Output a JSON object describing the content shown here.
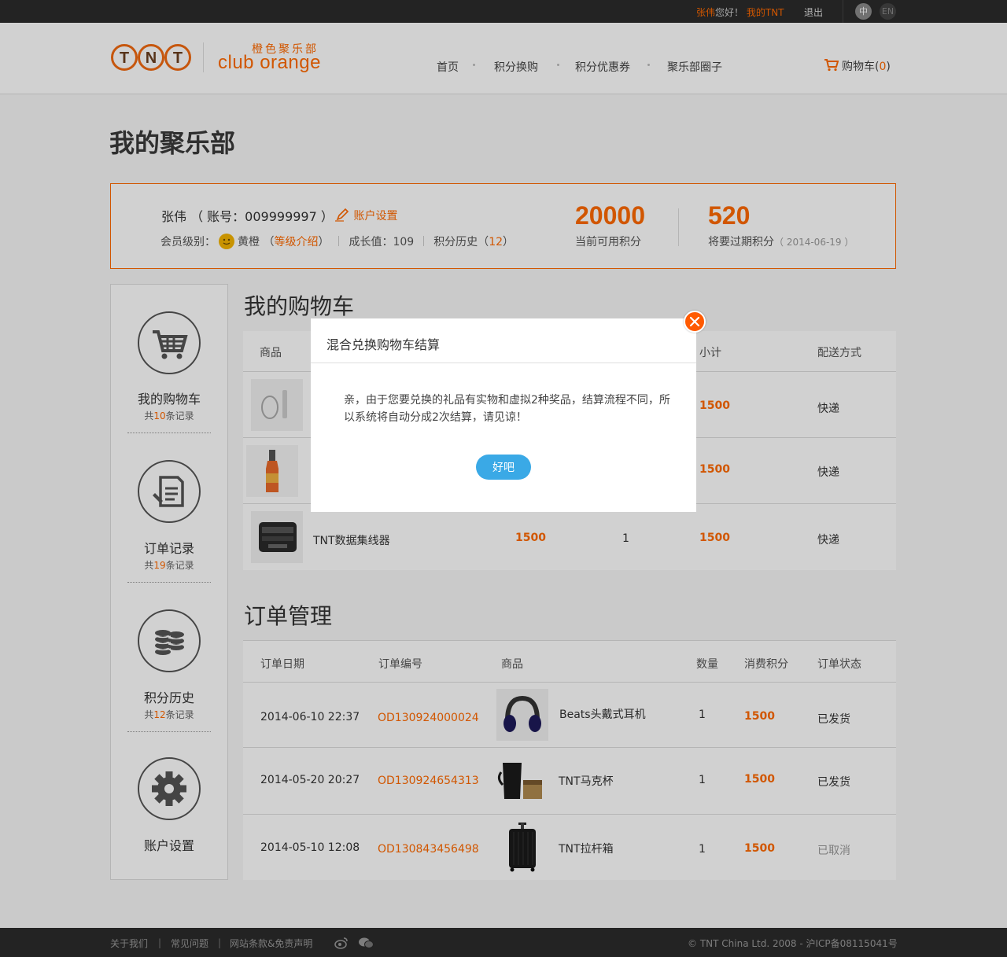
{
  "topbar": {
    "user_name": "张伟",
    "greeting": "您好！",
    "my_tnt": "我的TNT",
    "logout": "退出",
    "lang_zh": "中",
    "lang_en": "EN"
  },
  "header": {
    "logo_cn": "橙色聚乐部",
    "logo_en": "club orange",
    "nav": [
      "首页",
      "积分换购",
      "积分优惠券",
      "聚乐部圈子"
    ],
    "cart_label": "购物车(",
    "cart_count": "0",
    "cart_close": ")"
  },
  "page_title": "我的聚乐部",
  "account": {
    "name_line": "张伟 （ 账号：009999997 ）",
    "settings_link": "账户设置",
    "level_label": "会员级别：",
    "level_value": "黄橙",
    "level_intro_open": "（",
    "level_intro": "等级介绍",
    "level_intro_close": "）",
    "growth": "成长值：109",
    "history_label": "积分历史（",
    "history_count": "12",
    "history_close": "）",
    "available_points": "20000",
    "available_label": "当前可用积分",
    "expiring_points": "520",
    "expiring_label": "将要过期积分",
    "expiring_date": "（ 2014-06-19 ）"
  },
  "sidebar": {
    "items": [
      {
        "title": "我的购物车",
        "count_pre": "共",
        "count": "10",
        "count_post": "条记录"
      },
      {
        "title": "订单记录",
        "count_pre": "共",
        "count": "19",
        "count_post": "条记录"
      },
      {
        "title": "积分历史",
        "count_pre": "共",
        "count": "12",
        "count_post": "条记录"
      },
      {
        "title": "账户设置"
      }
    ]
  },
  "cart_section": {
    "title": "我的购物车",
    "headers": {
      "product": "商品",
      "subtotal": "小计",
      "delivery": "配送方式"
    },
    "rows": [
      {
        "subtotal": "1500",
        "delivery": "快递"
      },
      {
        "subtotal": "1500",
        "delivery": "快递"
      },
      {
        "name": "TNT数据集线器",
        "price": "1500",
        "qty": "1",
        "subtotal": "1500",
        "delivery": "快递"
      }
    ]
  },
  "orders_section": {
    "title": "订单管理",
    "headers": {
      "date": "订单日期",
      "id": "订单编号",
      "product": "商品",
      "qty": "数量",
      "points": "消费积分",
      "status": "订单状态"
    },
    "rows": [
      {
        "date": "2014-06-10 22:37",
        "id": "OD130924000024",
        "product": "Beats头戴式耳机",
        "qty": "1",
        "points": "1500",
        "status": "已发货"
      },
      {
        "date": "2014-05-20 20:27",
        "id": "OD130924654313",
        "product": "TNT马克杯",
        "qty": "1",
        "points": "1500",
        "status": "已发货"
      },
      {
        "date": "2014-05-10 12:08",
        "id": "OD130843456498",
        "product": "TNT拉杆箱",
        "qty": "1",
        "points": "1500",
        "status": "已取消"
      }
    ]
  },
  "modal": {
    "title": "混合兑换购物车结算",
    "body": "亲，由于您要兑换的礼品有实物和虚拟2种奖品，结算流程不同，所以系统将自动分成2次结算，请见谅！",
    "ok": "好吧"
  },
  "footer": {
    "links": [
      "关于我们",
      "常见问题",
      "网站条款&免责声明"
    ],
    "copyright": "© TNT China Ltd. 2008 - 沪ICP备08115041号"
  },
  "colors": {
    "accent": "#ff6a00",
    "button": "#3aa9e6",
    "dark": "#2b2b2b"
  },
  "icons": [
    "cart-icon",
    "pencil-icon",
    "smile-icon",
    "order-icon",
    "coins-icon",
    "gear-icon",
    "close-icon",
    "weibo-icon",
    "wechat-icon"
  ]
}
